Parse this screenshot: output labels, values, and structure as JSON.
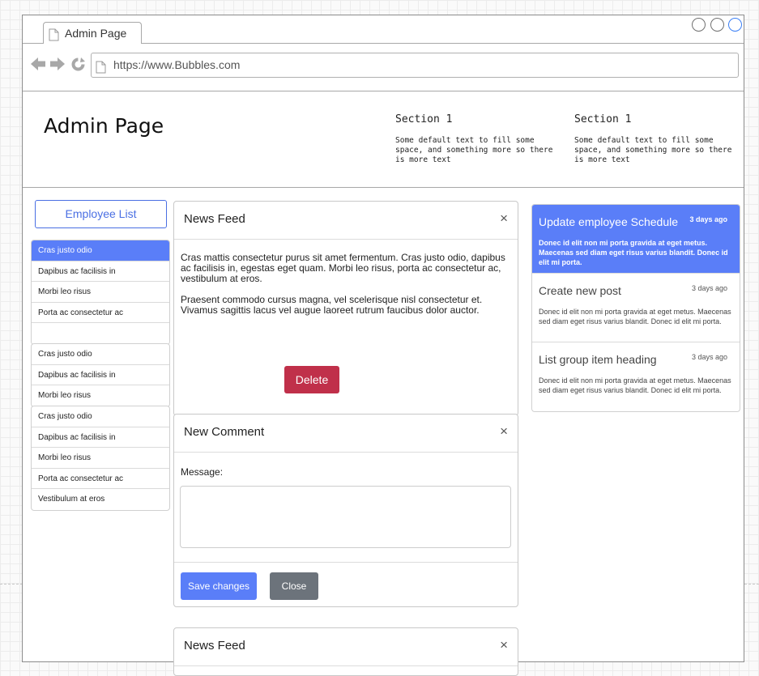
{
  "browser": {
    "tab_label": "Admin Page",
    "url": "https://www.Bubbles.com"
  },
  "header": {
    "title": "Admin Page",
    "sections": [
      {
        "title": "Section 1",
        "text": "Some default text to fill some space, and something more so there is more text"
      },
      {
        "title": "Section 1",
        "text": "Some default text to fill some space, and something more so there is more text"
      }
    ]
  },
  "sidebar": {
    "button_label": "Employee List",
    "group1": [
      "Cras justo odio",
      "Dapibus ac facilisis in",
      "Morbi leo risus",
      "Porta ac consectetur ac",
      ""
    ],
    "group2": [
      "Cras justo odio",
      "Dapibus ac facilisis in",
      "Morbi leo risus"
    ],
    "group3": [
      "Cras justo odio",
      "Dapibus ac facilisis in",
      "Morbi leo risus",
      "Porta ac consectetur ac",
      "Vestibulum at eros"
    ],
    "active_item": "Cras justo odio"
  },
  "news_feed": {
    "title": "News Feed",
    "close_symbol": "×",
    "paragraphs": [
      "Cras mattis consectetur purus sit amet fermentum. Cras justo odio, dapibus ac facilisis in, egestas eget quam. Morbi leo risus, porta ac consectetur ac, vestibulum at eros.",
      "Praesent commodo cursus magna, vel scelerisque nisl consectetur et. Vivamus sagittis lacus vel augue laoreet rutrum faucibus dolor auctor."
    ],
    "delete_label": "Delete"
  },
  "new_comment": {
    "title": "New Comment",
    "close_symbol": "×",
    "message_label": "Message:",
    "message_value": "",
    "save_label": "Save changes",
    "close_label": "Close"
  },
  "news_feed_2": {
    "title": "News Feed",
    "close_symbol": "×"
  },
  "right_list": [
    {
      "heading": "Update employee Schedule",
      "time": "3 days ago",
      "text": "Donec id elit non mi porta gravida at eget metus. Maecenas sed diam eget risus varius blandit. Donec id elit mi porta."
    },
    {
      "heading": "Create new post",
      "time": "3 days ago",
      "text": "Donec id elit non mi porta gravida at eget metus. Maecenas sed diam eget risus varius blandit. Donec id elit mi porta."
    },
    {
      "heading": "List group item heading",
      "time": "3 days ago",
      "text": "Donec id elit non mi porta gravida at eget metus. Maecenas sed diam eget risus varius blandit. Donec id elit mi porta."
    }
  ],
  "colors": {
    "primary": "#5a7ef8",
    "danger": "#c0304a",
    "secondary": "#6c737b"
  },
  "icons": [
    "document-icon",
    "back-arrow-icon",
    "forward-arrow-icon",
    "reload-icon",
    "close-icon"
  ]
}
